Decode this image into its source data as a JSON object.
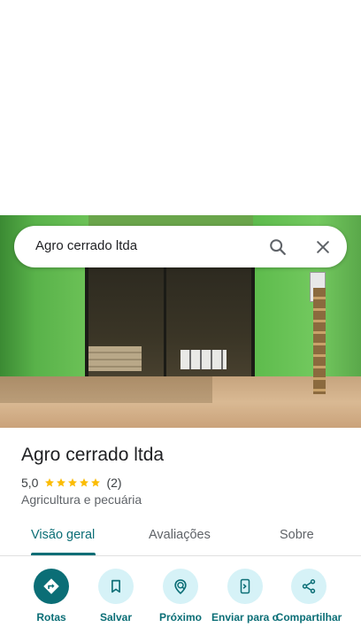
{
  "search": {
    "query": "Agro cerrado ltda"
  },
  "place": {
    "name": "Agro cerrado ltda",
    "rating": "5,0",
    "stars": 5,
    "review_count": "(2)",
    "category": "Agricultura e pecuária"
  },
  "tabs": [
    {
      "label": "Visão geral",
      "active": true
    },
    {
      "label": "Avaliações",
      "active": false
    },
    {
      "label": "Sobre",
      "active": false
    }
  ],
  "actions": [
    {
      "label": "Rotas",
      "icon": "directions-icon"
    },
    {
      "label": "Salvar",
      "icon": "bookmark-icon"
    },
    {
      "label": "Próximo",
      "icon": "nearby-icon"
    },
    {
      "label": "Enviar para o",
      "icon": "send-to-phone-icon"
    },
    {
      "label": "Compartilhar",
      "icon": "share-icon"
    }
  ],
  "colors": {
    "accent": "#0b6e76",
    "accent_light": "#d6f2f7",
    "star": "#fbbc04"
  }
}
